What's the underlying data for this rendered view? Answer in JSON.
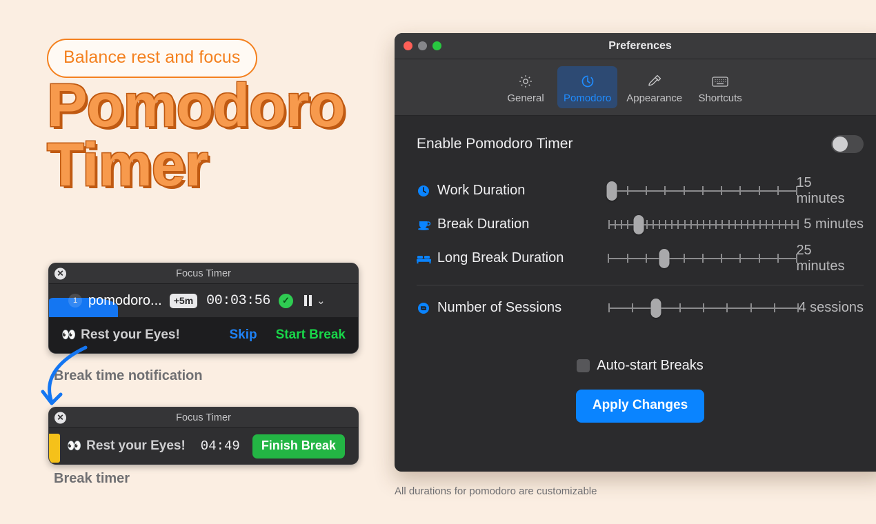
{
  "theme": {
    "background": "#fbeee2",
    "accent_orange": "#f4811f",
    "hero_fill": "#f79a4d",
    "hero_shadow": "#c05a12",
    "accent_blue": "#0a84ff",
    "accent_green": "#23b544"
  },
  "hero": {
    "pill_label": "Balance rest and focus",
    "title_line1": "Pomodoro",
    "title_line2": "Timer"
  },
  "notification_break": {
    "window_title": "Focus Timer",
    "close_icon": "close-circle-icon",
    "session_number": "1",
    "task_name": "pomodoro...",
    "extend_chip": "+5m",
    "elapsed": "00:03:56",
    "complete_icon": "check-circle-icon",
    "pause_icon": "pause-icon",
    "chevron_icon": "chevron-down-icon",
    "eyes_icon": "👀",
    "message": "Rest your Eyes!",
    "skip_label": "Skip",
    "start_break_label": "Start Break",
    "caption": "Break time notification"
  },
  "notification_timer": {
    "window_title": "Focus Timer",
    "close_icon": "close-circle-icon",
    "eyes_icon": "👀",
    "message": "Rest your Eyes!",
    "remaining": "04:49",
    "finish_label": "Finish Break",
    "caption": "Break timer"
  },
  "preferences": {
    "title": "Preferences",
    "traffic_lights": [
      "#ff5f57",
      "#86868a",
      "#28c840"
    ],
    "tabs": [
      {
        "label": "General",
        "icon": "gear-icon",
        "active": false
      },
      {
        "label": "Pomodoro",
        "icon": "timer-icon",
        "active": true
      },
      {
        "label": "Appearance",
        "icon": "paintbrush-icon",
        "active": false
      },
      {
        "label": "Shortcuts",
        "icon": "keyboard-icon",
        "active": false
      }
    ],
    "enable": {
      "label": "Enable Pomodoro Timer",
      "state": "off"
    },
    "sliders": [
      {
        "icon": "clock-icon",
        "label": "Work Duration",
        "value": "15 minutes",
        "knob_pct": 2,
        "ticks": 10,
        "dense": false
      },
      {
        "icon": "coffee-icon",
        "label": "Break Duration",
        "value": "5 minutes",
        "knob_pct": 16,
        "ticks": 30,
        "dense": true
      },
      {
        "icon": "bed-icon",
        "label": "Long Break Duration",
        "value": "25 minutes",
        "knob_pct": 30,
        "ticks": 10,
        "dense": false
      },
      {
        "icon": "repeat-icon",
        "label": "Number of Sessions",
        "value": "4 sessions",
        "knob_pct": 25,
        "ticks": 8,
        "dense": false
      }
    ],
    "checkbox": {
      "label": "Auto-start Breaks",
      "state": "unchecked"
    },
    "apply_label": "Apply Changes",
    "caption": "All durations for pomodoro are customizable"
  }
}
